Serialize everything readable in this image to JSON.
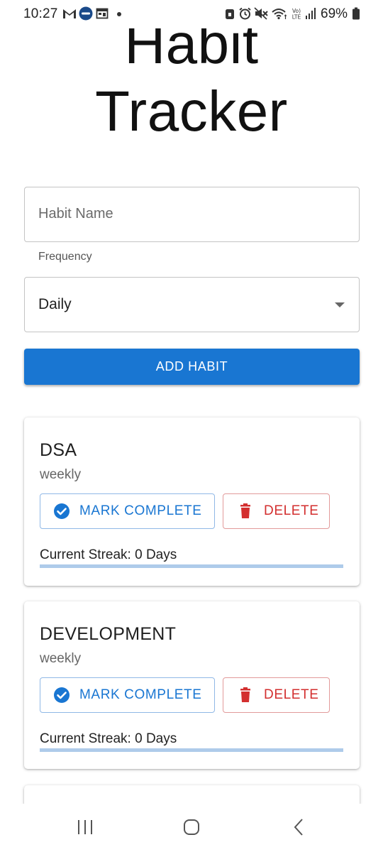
{
  "status_bar": {
    "time": "10:27",
    "battery": "69%",
    "icons": [
      "gmail-icon",
      "app-badge-icon",
      "calendar-icon",
      "notification-dot",
      "lock-icon",
      "alarm-icon",
      "mute-icon",
      "wifi-icon",
      "volte-icon",
      "signal-icon",
      "battery-icon"
    ]
  },
  "header": {
    "title_line1": "Habit",
    "title_line2": "Tracker"
  },
  "form": {
    "habit_name_placeholder": "Habit Name",
    "habit_name_value": "",
    "frequency_label": "Frequency",
    "frequency_value": "Daily",
    "add_button_label": "ADD HABIT"
  },
  "habits": [
    {
      "name": "DSA",
      "frequency": "weekly",
      "complete_label": "MARK COMPLETE",
      "delete_label": "DELETE",
      "streak_text": "Current Streak: 0 Days",
      "streak_progress": 0
    },
    {
      "name": "DEVELOPMENT",
      "frequency": "weekly",
      "complete_label": "MARK COMPLETE",
      "delete_label": "DELETE",
      "streak_text": "Current Streak: 0 Days",
      "streak_progress": 0
    }
  ],
  "colors": {
    "primary": "#1976d2",
    "danger": "#d32f2f",
    "progress_track": "#aecbea"
  },
  "nav": {
    "icons": [
      "recent-apps-icon",
      "home-icon",
      "back-icon"
    ]
  }
}
